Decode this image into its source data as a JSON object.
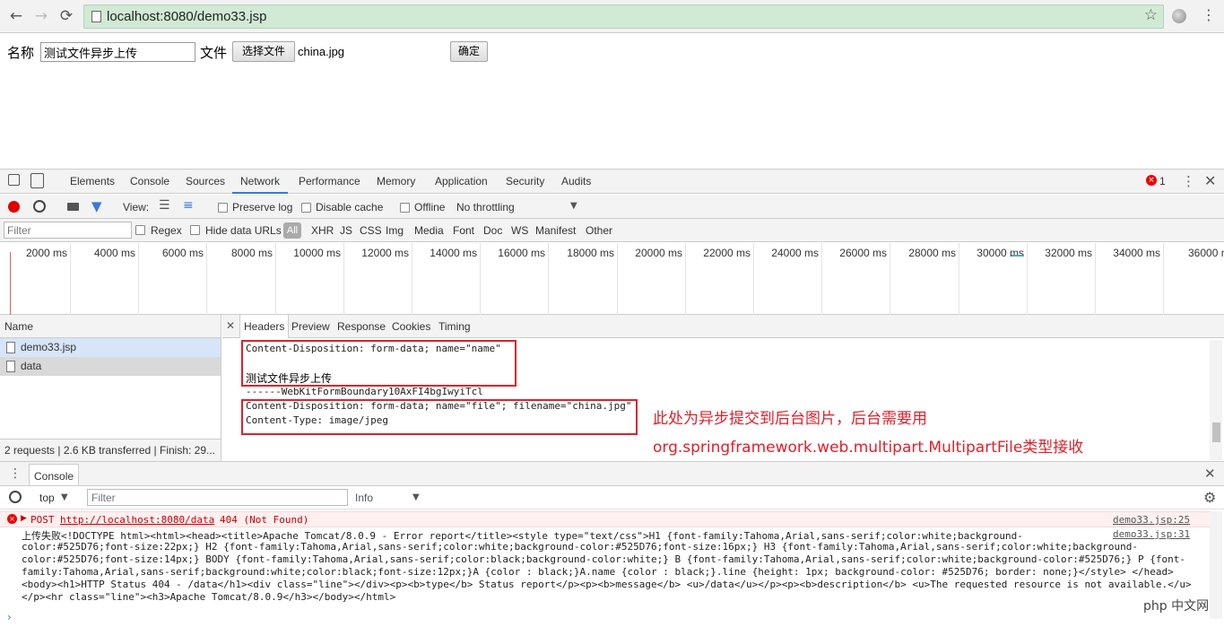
{
  "browser": {
    "back_icon": "←",
    "forward_icon": "→",
    "reload_icon": "⟳",
    "url": "localhost:8080/demo33.jsp",
    "star_icon": "☆",
    "menu_icon": "⋮"
  },
  "page": {
    "name_label": "名称",
    "name_value": "测试文件异步上传",
    "file_label": "文件",
    "choose_file_button": "选择文件",
    "chosen_file": "china.jpg",
    "submit_button": "确定"
  },
  "devtools": {
    "tabs": [
      "Elements",
      "Console",
      "Sources",
      "Network",
      "Performance",
      "Memory",
      "Application",
      "Security",
      "Audits"
    ],
    "active_tab": "Network",
    "error_count": "1",
    "network_toolbar": {
      "view_label": "View:",
      "preserve_log": "Preserve log",
      "disable_cache": "Disable cache",
      "offline": "Offline",
      "throttling": "No throttling"
    },
    "filter": {
      "placeholder": "Filter",
      "regex": "Regex",
      "hide_data_urls": "Hide data URLs",
      "types": [
        "All",
        "XHR",
        "JS",
        "CSS",
        "Img",
        "Media",
        "Font",
        "Doc",
        "WS",
        "Manifest",
        "Other"
      ]
    },
    "timeline_ticks": [
      "2000 ms",
      "4000 ms",
      "6000 ms",
      "8000 ms",
      "10000 ms",
      "12000 ms",
      "14000 ms",
      "16000 ms",
      "18000 ms",
      "20000 ms",
      "22000 ms",
      "24000 ms",
      "26000 ms",
      "28000 ms",
      "30000 ms",
      "32000 ms",
      "34000 ms",
      "36000 m"
    ],
    "requests": {
      "header": "Name",
      "rows": [
        "demo33.jsp",
        "data"
      ],
      "status": "2 requests | 2.6 KB transferred | Finish: 29..."
    },
    "detail": {
      "tabs": [
        "Headers",
        "Preview",
        "Response",
        "Cookies",
        "Timing"
      ],
      "active_tab": "Headers",
      "lines": [
        "Content-Disposition: form-data; name=\"name\"",
        "",
        "测试文件异步上传",
        "------WebKitFormBoundary10AxFI4bgIwyiTcl",
        "Content-Disposition: form-data; name=\"file\"; filename=\"china.jpg\"",
        "Content-Type: image/jpeg"
      ],
      "annotation_line1": "此处为异步提交到后台图片，后台需要用",
      "annotation_line2": "org.springframework.web.multipart.MultipartFile类型接收"
    },
    "console": {
      "tab_label": "Console",
      "context": "top",
      "filter_placeholder": "Filter",
      "level": "Info",
      "error_method": "POST",
      "error_url": "http://localhost:8080/data",
      "error_status": "404 (Not Found)",
      "error_source": "demo33.jsp:25",
      "log_source": "demo33.jsp:31",
      "log_lines": [
        "上传失败<!DOCTYPE html><html><head><title>Apache Tomcat/8.0.9 - Error report</title><style type=\"text/css\">H1 {font-family:Tahoma,Arial,sans-serif;color:white;background-",
        "color:#525D76;font-size:22px;} H2 {font-family:Tahoma,Arial,sans-serif;color:white;background-color:#525D76;font-size:16px;} H3 {font-family:Tahoma,Arial,sans-serif;color:white;background-",
        "color:#525D76;font-size:14px;} BODY {font-family:Tahoma,Arial,sans-serif;color:black;background-color:white;} B {font-family:Tahoma,Arial,sans-serif;color:white;background-color:#525D76;} P {font-",
        "family:Tahoma,Arial,sans-serif;background:white;color:black;font-size:12px;}A {color : black;}A.name {color : black;}.line {height: 1px; background-color: #525D76; border: none;}</style> </head>",
        "<body><h1>HTTP Status 404 - /data</h1><div class=\"line\"></div><p><b>type</b> Status report</p><p><b>message</b> <u>/data</u></p><p><b>description</b> <u>The requested resource is not available.</u>",
        "</p><hr class=\"line\"><h3>Apache Tomcat/8.0.9</h3></body></html>"
      ]
    },
    "watermark": "php 中文网"
  },
  "colors": {
    "omnibox": "#d1ead5",
    "annotation_red": "#e0202a",
    "active_tab_blue": "#3879d9",
    "record_red": "#e00000"
  }
}
